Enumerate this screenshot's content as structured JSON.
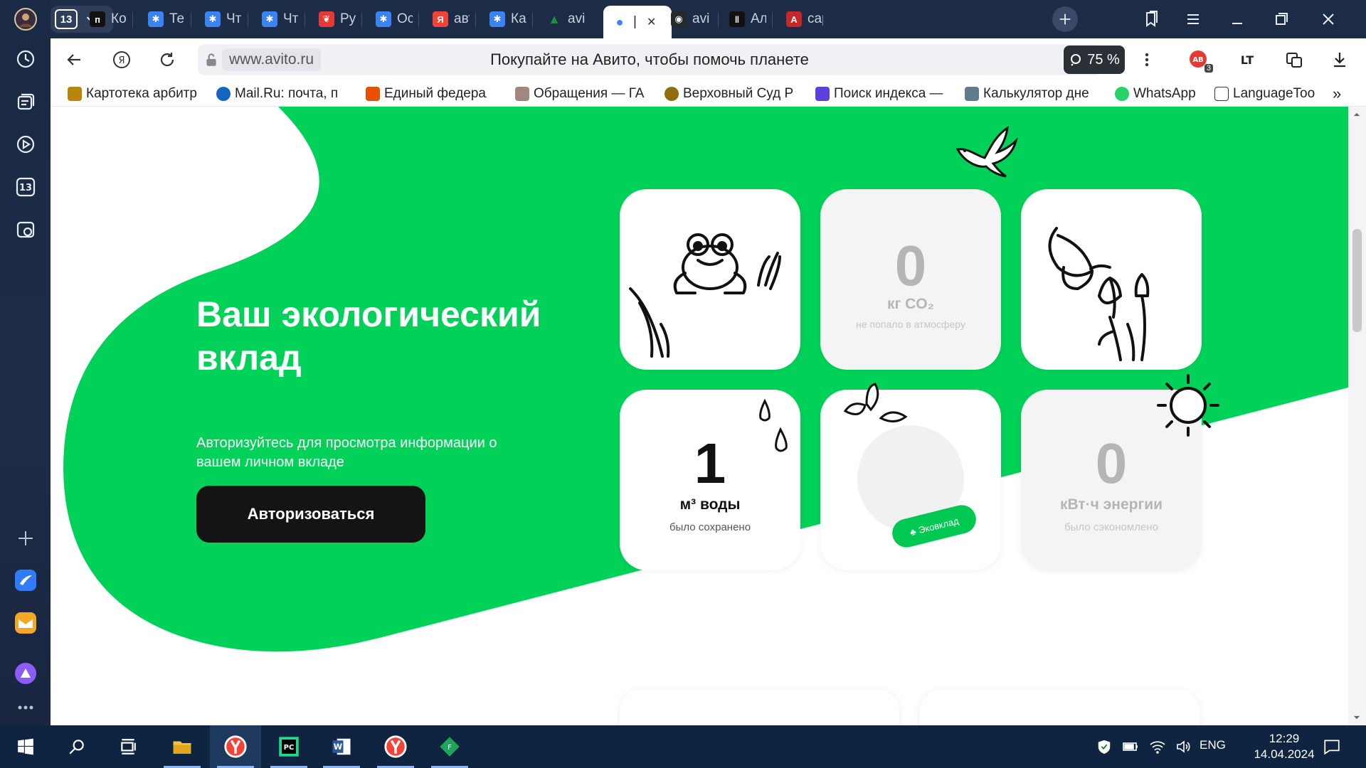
{
  "browser": {
    "tab_count": "13",
    "tabs": [
      {
        "label": "Ко",
        "color": "#111111",
        "glyph": "п"
      },
      {
        "label": "Те",
        "color": "#3b82f6",
        "glyph": "✱"
      },
      {
        "label": "Чт",
        "color": "#3b82f6",
        "glyph": "✱"
      },
      {
        "label": "Чт",
        "color": "#3b82f6",
        "glyph": "✱"
      },
      {
        "label": "Ру",
        "color": "#e53935",
        "glyph": "❦"
      },
      {
        "label": "Ос",
        "color": "#3b82f6",
        "glyph": "✱"
      },
      {
        "label": "авт",
        "color": "#f44336",
        "glyph": "Я"
      },
      {
        "label": "Ка",
        "color": "#3b82f6",
        "glyph": "✱"
      },
      {
        "label": "avi",
        "color": "#1e8e3e",
        "glyph": "▲"
      },
      {
        "label": "|",
        "color": "#ffffff",
        "glyph": "●"
      },
      {
        "label": "avi",
        "color": "#24292e",
        "glyph": "◉"
      },
      {
        "label": "Ал",
        "color": "#111111",
        "glyph": "‖"
      },
      {
        "label": "сар",
        "color": "#c62828",
        "glyph": "A"
      }
    ],
    "url": "www.avito.ru",
    "page_title": "Покупайте на Авито, чтобы помочь планете",
    "zoom": "75 %",
    "bookmarks": [
      "Картотека арбитр",
      "Mail.Ru: почта, по",
      "Единый федерал",
      "Обращения — ГА",
      "Верховный Суд Р",
      "Поиск индекса —",
      "Калькулятор дне",
      "WhatsApp",
      "LanguageToo"
    ],
    "extension_badge": "3"
  },
  "hero": {
    "title": "Ваш экологический вклад",
    "subtitle": "Авторизуйтесь для просмотра информации о вашем личном вкладе",
    "button": "Авторизоваться"
  },
  "cards": {
    "co2": {
      "value": "0",
      "unit": "кг CO₂",
      "note": "не попало в атмосферу"
    },
    "water": {
      "value": "1",
      "unit": "м³ воды",
      "note": "было сохранено"
    },
    "badge": "Эковклад",
    "energy": {
      "value": "0",
      "unit": "кВт·ч энергии",
      "note": "было сэкономлено"
    }
  },
  "taskbar": {
    "lang": "ENG",
    "time": "12:29",
    "date": "14.04.2024"
  },
  "colors": {
    "accent_green": "#00d259",
    "dark_button": "#141414",
    "browser_chrome": "#1c2c46"
  }
}
